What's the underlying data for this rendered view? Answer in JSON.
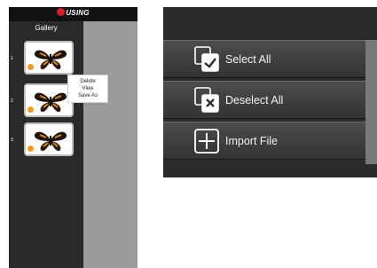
{
  "gallery": {
    "logo": "USING",
    "title": "Gallery",
    "thumbnails": [
      {
        "index": "1"
      },
      {
        "index": "2"
      },
      {
        "index": "3"
      }
    ],
    "context_menu": [
      "Delete",
      "View",
      "Save As"
    ]
  },
  "actions": {
    "items": [
      {
        "label": "Select All",
        "icon": "select-all-icon"
      },
      {
        "label": "Deselect All",
        "icon": "deselect-all-icon"
      },
      {
        "label": "Import File",
        "icon": "import-file-icon"
      }
    ]
  },
  "colors": {
    "panel": "#2a2a2a",
    "strip": "#9a9a98",
    "badge": "#f39b1c",
    "logo_mark": "#d51e27"
  }
}
